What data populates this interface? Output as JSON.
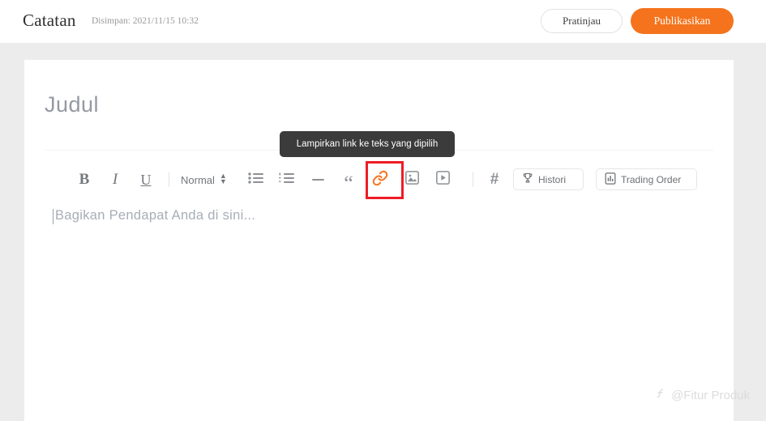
{
  "topbar": {
    "app_title": "Catatan",
    "saved_stamp": "Disimpan: 2021/11/15 10:32",
    "preview_button": "Pratinjau",
    "publish_button": "Publikasikan",
    "publish_color": "#f4731c"
  },
  "editor": {
    "title_placeholder": "Judul",
    "body_placeholder": "Bagikan Pendapat Anda di sini..."
  },
  "toolbar": {
    "bold": "B",
    "italic": "I",
    "underline": "U",
    "paragraph_style": "Normal",
    "bullet_list_icon": "bulleted-list-icon",
    "numbered_list_icon": "numbered-list-icon",
    "horizontal_rule_icon": "horizontal-rule-icon",
    "quote_glyph": "“",
    "link_icon": "link-icon",
    "image_icon": "image-icon",
    "video_icon": "video-icon",
    "hashtag_glyph": "#",
    "history_button": "Histori",
    "trading_order_button": "Trading Order",
    "highlight_color": "#ee1c25",
    "link_icon_color": "#f4731c"
  },
  "tooltip": {
    "text": "Lampirkan link ke teks yang dipilih"
  },
  "watermark": {
    "text": "@Fitur Produk"
  }
}
